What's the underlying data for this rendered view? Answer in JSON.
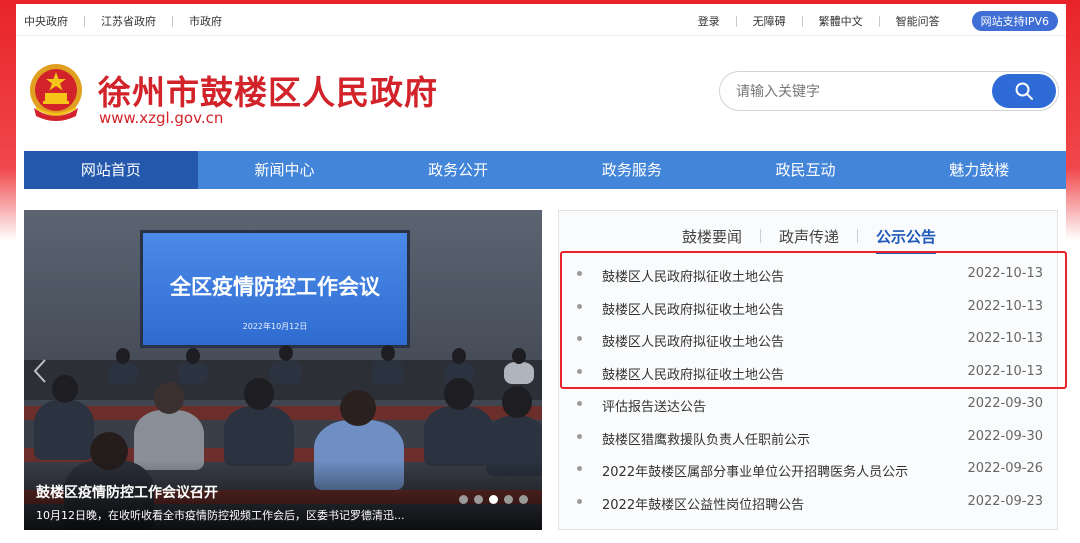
{
  "colors": {
    "frame_red": "#e8242a",
    "title_red": "#d2232a",
    "nav_blue": "#4385d9",
    "nav_active_blue": "#2458ad",
    "accent_blue": "#1e58b8",
    "search_button_blue": "#2e6bd6"
  },
  "topbar": {
    "left_links": [
      "中央政府",
      "江苏省政府",
      "市政府"
    ],
    "right_links": [
      "登录",
      "无障碍",
      "繁體中文",
      "智能问答"
    ],
    "ipv6_badge": "网站支持IPV6"
  },
  "header": {
    "title": "徐州市鼓楼区人民政府",
    "url": "www.xzgl.gov.cn",
    "emblem_icon": "national-emblem-icon"
  },
  "search": {
    "placeholder": "请输入关键字",
    "value": "",
    "button_icon": "search-icon"
  },
  "nav": {
    "items": [
      {
        "label": "网站首页",
        "active": true
      },
      {
        "label": "新闻中心",
        "active": false
      },
      {
        "label": "政务公开",
        "active": false
      },
      {
        "label": "政务服务",
        "active": false
      },
      {
        "label": "政民互动",
        "active": false
      },
      {
        "label": "魅力鼓楼",
        "active": false
      }
    ]
  },
  "carousel": {
    "screen_text": "全区疫情防控工作会议",
    "screen_date": "2022年10月12日",
    "title": "鼓楼区疫情防控工作会议召开",
    "caption": "10月12日晚，在收听收看全市疫情防控视频工作会后，区委书记罗德清迅...",
    "slide_count": 5,
    "active_slide": 3,
    "prev_icon": "chevron-left-icon"
  },
  "news_panel": {
    "tabs": [
      {
        "label": "鼓楼要闻",
        "active": false
      },
      {
        "label": "政声传递",
        "active": false
      },
      {
        "label": "公示公告",
        "active": true
      }
    ],
    "items": [
      {
        "title": "鼓楼区人民政府拟征收土地公告",
        "date": "2022-10-13"
      },
      {
        "title": "鼓楼区人民政府拟征收土地公告",
        "date": "2022-10-13"
      },
      {
        "title": "鼓楼区人民政府拟征收土地公告",
        "date": "2022-10-13"
      },
      {
        "title": "鼓楼区人民政府拟征收土地公告",
        "date": "2022-10-13"
      },
      {
        "title": "评估报告送达公告",
        "date": "2022-09-30"
      },
      {
        "title": "鼓楼区猎鹰救援队负责人任职前公示",
        "date": "2022-09-30"
      },
      {
        "title": "2022年鼓楼区属部分事业单位公开招聘医务人员公示",
        "date": "2022-09-26"
      },
      {
        "title": "2022年鼓楼区公益性岗位招聘公告",
        "date": "2022-09-23"
      }
    ],
    "highlighted_rows": 4
  }
}
